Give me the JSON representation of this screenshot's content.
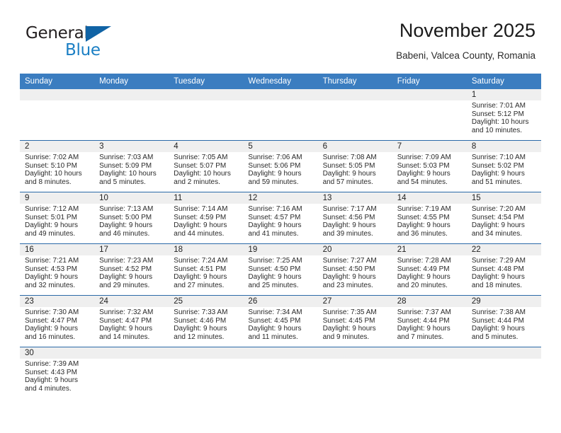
{
  "logo": {
    "word1": "General",
    "word2": "Blue",
    "triangle_color": "#1063a5",
    "blue_color": "#1b7fc4"
  },
  "header": {
    "title": "November 2025",
    "subtitle": "Babeni, Valcea County, Romania"
  },
  "theme": {
    "header_bg": "#3b7dc0",
    "row_border": "#2b6aa8",
    "daynum_bg": "#efefef"
  },
  "weekdays": [
    "Sunday",
    "Monday",
    "Tuesday",
    "Wednesday",
    "Thursday",
    "Friday",
    "Saturday"
  ],
  "weeks": [
    [
      {
        "blank": true,
        "shaded": false
      },
      {
        "blank": true,
        "shaded": false
      },
      {
        "blank": true,
        "shaded": false
      },
      {
        "blank": true,
        "shaded": false
      },
      {
        "blank": true,
        "shaded": false
      },
      {
        "blank": true,
        "shaded": false
      },
      {
        "day": "1",
        "sunrise": "Sunrise: 7:01 AM",
        "sunset": "Sunset: 5:12 PM",
        "daylight1": "Daylight: 10 hours",
        "daylight2": "and 10 minutes."
      }
    ],
    [
      {
        "day": "2",
        "sunrise": "Sunrise: 7:02 AM",
        "sunset": "Sunset: 5:10 PM",
        "daylight1": "Daylight: 10 hours",
        "daylight2": "and 8 minutes."
      },
      {
        "day": "3",
        "sunrise": "Sunrise: 7:03 AM",
        "sunset": "Sunset: 5:09 PM",
        "daylight1": "Daylight: 10 hours",
        "daylight2": "and 5 minutes."
      },
      {
        "day": "4",
        "sunrise": "Sunrise: 7:05 AM",
        "sunset": "Sunset: 5:07 PM",
        "daylight1": "Daylight: 10 hours",
        "daylight2": "and 2 minutes."
      },
      {
        "day": "5",
        "sunrise": "Sunrise: 7:06 AM",
        "sunset": "Sunset: 5:06 PM",
        "daylight1": "Daylight: 9 hours",
        "daylight2": "and 59 minutes."
      },
      {
        "day": "6",
        "sunrise": "Sunrise: 7:08 AM",
        "sunset": "Sunset: 5:05 PM",
        "daylight1": "Daylight: 9 hours",
        "daylight2": "and 57 minutes."
      },
      {
        "day": "7",
        "sunrise": "Sunrise: 7:09 AM",
        "sunset": "Sunset: 5:03 PM",
        "daylight1": "Daylight: 9 hours",
        "daylight2": "and 54 minutes."
      },
      {
        "day": "8",
        "sunrise": "Sunrise: 7:10 AM",
        "sunset": "Sunset: 5:02 PM",
        "daylight1": "Daylight: 9 hours",
        "daylight2": "and 51 minutes."
      }
    ],
    [
      {
        "day": "9",
        "sunrise": "Sunrise: 7:12 AM",
        "sunset": "Sunset: 5:01 PM",
        "daylight1": "Daylight: 9 hours",
        "daylight2": "and 49 minutes."
      },
      {
        "day": "10",
        "sunrise": "Sunrise: 7:13 AM",
        "sunset": "Sunset: 5:00 PM",
        "daylight1": "Daylight: 9 hours",
        "daylight2": "and 46 minutes."
      },
      {
        "day": "11",
        "sunrise": "Sunrise: 7:14 AM",
        "sunset": "Sunset: 4:59 PM",
        "daylight1": "Daylight: 9 hours",
        "daylight2": "and 44 minutes."
      },
      {
        "day": "12",
        "sunrise": "Sunrise: 7:16 AM",
        "sunset": "Sunset: 4:57 PM",
        "daylight1": "Daylight: 9 hours",
        "daylight2": "and 41 minutes."
      },
      {
        "day": "13",
        "sunrise": "Sunrise: 7:17 AM",
        "sunset": "Sunset: 4:56 PM",
        "daylight1": "Daylight: 9 hours",
        "daylight2": "and 39 minutes."
      },
      {
        "day": "14",
        "sunrise": "Sunrise: 7:19 AM",
        "sunset": "Sunset: 4:55 PM",
        "daylight1": "Daylight: 9 hours",
        "daylight2": "and 36 minutes."
      },
      {
        "day": "15",
        "sunrise": "Sunrise: 7:20 AM",
        "sunset": "Sunset: 4:54 PM",
        "daylight1": "Daylight: 9 hours",
        "daylight2": "and 34 minutes."
      }
    ],
    [
      {
        "day": "16",
        "sunrise": "Sunrise: 7:21 AM",
        "sunset": "Sunset: 4:53 PM",
        "daylight1": "Daylight: 9 hours",
        "daylight2": "and 32 minutes."
      },
      {
        "day": "17",
        "sunrise": "Sunrise: 7:23 AM",
        "sunset": "Sunset: 4:52 PM",
        "daylight1": "Daylight: 9 hours",
        "daylight2": "and 29 minutes."
      },
      {
        "day": "18",
        "sunrise": "Sunrise: 7:24 AM",
        "sunset": "Sunset: 4:51 PM",
        "daylight1": "Daylight: 9 hours",
        "daylight2": "and 27 minutes."
      },
      {
        "day": "19",
        "sunrise": "Sunrise: 7:25 AM",
        "sunset": "Sunset: 4:50 PM",
        "daylight1": "Daylight: 9 hours",
        "daylight2": "and 25 minutes."
      },
      {
        "day": "20",
        "sunrise": "Sunrise: 7:27 AM",
        "sunset": "Sunset: 4:50 PM",
        "daylight1": "Daylight: 9 hours",
        "daylight2": "and 23 minutes."
      },
      {
        "day": "21",
        "sunrise": "Sunrise: 7:28 AM",
        "sunset": "Sunset: 4:49 PM",
        "daylight1": "Daylight: 9 hours",
        "daylight2": "and 20 minutes."
      },
      {
        "day": "22",
        "sunrise": "Sunrise: 7:29 AM",
        "sunset": "Sunset: 4:48 PM",
        "daylight1": "Daylight: 9 hours",
        "daylight2": "and 18 minutes."
      }
    ],
    [
      {
        "day": "23",
        "sunrise": "Sunrise: 7:30 AM",
        "sunset": "Sunset: 4:47 PM",
        "daylight1": "Daylight: 9 hours",
        "daylight2": "and 16 minutes."
      },
      {
        "day": "24",
        "sunrise": "Sunrise: 7:32 AM",
        "sunset": "Sunset: 4:47 PM",
        "daylight1": "Daylight: 9 hours",
        "daylight2": "and 14 minutes."
      },
      {
        "day": "25",
        "sunrise": "Sunrise: 7:33 AM",
        "sunset": "Sunset: 4:46 PM",
        "daylight1": "Daylight: 9 hours",
        "daylight2": "and 12 minutes."
      },
      {
        "day": "26",
        "sunrise": "Sunrise: 7:34 AM",
        "sunset": "Sunset: 4:45 PM",
        "daylight1": "Daylight: 9 hours",
        "daylight2": "and 11 minutes."
      },
      {
        "day": "27",
        "sunrise": "Sunrise: 7:35 AM",
        "sunset": "Sunset: 4:45 PM",
        "daylight1": "Daylight: 9 hours",
        "daylight2": "and 9 minutes."
      },
      {
        "day": "28",
        "sunrise": "Sunrise: 7:37 AM",
        "sunset": "Sunset: 4:44 PM",
        "daylight1": "Daylight: 9 hours",
        "daylight2": "and 7 minutes."
      },
      {
        "day": "29",
        "sunrise": "Sunrise: 7:38 AM",
        "sunset": "Sunset: 4:44 PM",
        "daylight1": "Daylight: 9 hours",
        "daylight2": "and 5 minutes."
      }
    ],
    [
      {
        "day": "30",
        "sunrise": "Sunrise: 7:39 AM",
        "sunset": "Sunset: 4:43 PM",
        "daylight1": "Daylight: 9 hours",
        "daylight2": "and 4 minutes."
      },
      {
        "blank": true,
        "shaded": false
      },
      {
        "blank": true,
        "shaded": false
      },
      {
        "blank": true,
        "shaded": false
      },
      {
        "blank": true,
        "shaded": false
      },
      {
        "blank": true,
        "shaded": false
      },
      {
        "blank": true,
        "shaded": false
      }
    ]
  ]
}
